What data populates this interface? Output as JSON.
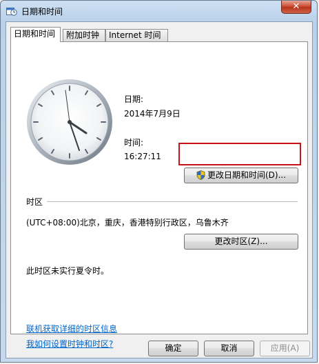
{
  "window": {
    "title": "日期和时间",
    "close_glyph": "✕"
  },
  "tabs": [
    {
      "label": "日期和时间"
    },
    {
      "label": "附加时钟"
    },
    {
      "label": "Internet 时间"
    }
  ],
  "datetime": {
    "date_label": "日期:",
    "date_value": "2014年7月9日",
    "time_label": "时间:",
    "time_value": "16:27:11",
    "change_datetime_button": "更改日期和时间(D)..."
  },
  "timezone": {
    "section_label": "时区",
    "value": "(UTC+08:00)北京，重庆，香港特别行政区，乌鲁木齐",
    "change_timezone_button": "更改时区(Z)...",
    "dst_note": "此时区未实行夏令时。"
  },
  "links": {
    "online_info": "联机获取详细的时区信息",
    "how_to": "我如何设置时钟和时区?"
  },
  "footer": {
    "ok": "确定",
    "cancel": "取消",
    "apply": "应用(A)"
  },
  "icons": {
    "clock": "clock-icon",
    "shield": "uac-shield-icon",
    "title": "calendar-clock-icon"
  }
}
